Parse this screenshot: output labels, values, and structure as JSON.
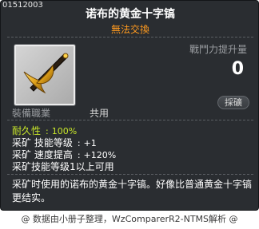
{
  "item": {
    "id": "01512003",
    "name": "诺布的黄金十字镐",
    "trade_status": "無法交換"
  },
  "combat_power": {
    "label": "戰鬥力提升量",
    "value": "0"
  },
  "mining_button": {
    "label": "採礦"
  },
  "job": {
    "label": "裝備職業",
    "value": "共用"
  },
  "stats": [
    {
      "label": "耐久性",
      "separator": ":",
      "value": "100%"
    },
    {
      "label": "采矿 技能等级",
      "separator": ":",
      "value": "+1"
    },
    {
      "label": "采矿 速度提高",
      "separator": ":",
      "value": "+120%"
    },
    {
      "label": "采矿技能等级1以上可用",
      "separator": "",
      "value": ""
    }
  ],
  "description": "采矿时使用的诺布的黄金十字镐。好像比普通黄金十字镐更结实。",
  "footer": "@ 数据由小册子整理，WzComparerR2-NTMS解析 @",
  "icon": "golden-pickaxe-icon",
  "colors": {
    "panel_background": "#2a2d31",
    "trade_status": "#ff9a1f",
    "durability": "#c8e62a",
    "pickaxe_gold": "#e0a21a"
  }
}
